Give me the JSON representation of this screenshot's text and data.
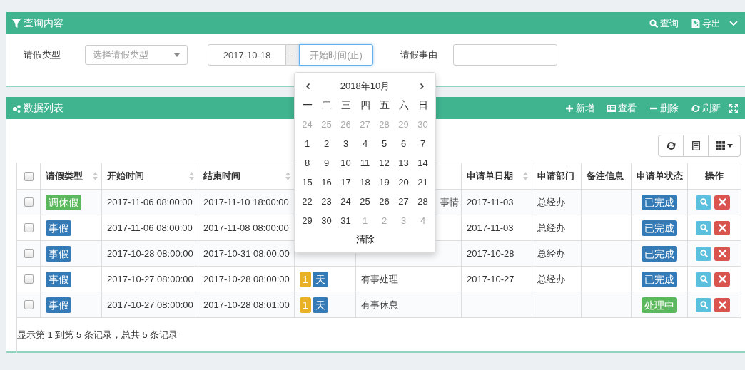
{
  "query_panel": {
    "title": "查询内容",
    "actions": [
      {
        "kind": "search",
        "label": "查询"
      },
      {
        "kind": "export",
        "label": "导出"
      }
    ],
    "fields": {
      "type_label": "请假类型",
      "type_placeholder": "选择请假类型",
      "date_from": "2017-10-18",
      "date_sep": "–",
      "date_to_placeholder": "开始时间(止)",
      "reason_label": "请假事由"
    }
  },
  "datepicker": {
    "title": "2018年10月",
    "weekdays": [
      "一",
      "二",
      "三",
      "四",
      "五",
      "六",
      "日"
    ],
    "days": [
      {
        "label": "24",
        "muted": true
      },
      {
        "label": "25",
        "muted": true
      },
      {
        "label": "26",
        "muted": true
      },
      {
        "label": "27",
        "muted": true
      },
      {
        "label": "28",
        "muted": true
      },
      {
        "label": "29",
        "muted": true
      },
      {
        "label": "30",
        "muted": true
      },
      {
        "label": "1",
        "muted": false
      },
      {
        "label": "2",
        "muted": false
      },
      {
        "label": "3",
        "muted": false
      },
      {
        "label": "4",
        "muted": false
      },
      {
        "label": "5",
        "muted": false
      },
      {
        "label": "6",
        "muted": false
      },
      {
        "label": "7",
        "muted": false
      },
      {
        "label": "8",
        "muted": false
      },
      {
        "label": "9",
        "muted": false
      },
      {
        "label": "10",
        "muted": false
      },
      {
        "label": "11",
        "muted": false
      },
      {
        "label": "12",
        "muted": false
      },
      {
        "label": "13",
        "muted": false
      },
      {
        "label": "14",
        "muted": false
      },
      {
        "label": "15",
        "muted": false
      },
      {
        "label": "16",
        "muted": false
      },
      {
        "label": "17",
        "muted": false
      },
      {
        "label": "18",
        "muted": false
      },
      {
        "label": "19",
        "muted": false
      },
      {
        "label": "20",
        "muted": false
      },
      {
        "label": "21",
        "muted": false
      },
      {
        "label": "22",
        "muted": false
      },
      {
        "label": "23",
        "muted": false
      },
      {
        "label": "24",
        "muted": false
      },
      {
        "label": "25",
        "muted": false
      },
      {
        "label": "26",
        "muted": false
      },
      {
        "label": "27",
        "muted": false
      },
      {
        "label": "28",
        "muted": false
      },
      {
        "label": "29",
        "muted": false
      },
      {
        "label": "30",
        "muted": false
      },
      {
        "label": "31",
        "muted": false
      },
      {
        "label": "1",
        "muted": true
      },
      {
        "label": "2",
        "muted": true
      },
      {
        "label": "3",
        "muted": true
      },
      {
        "label": "4",
        "muted": true
      }
    ],
    "clear": "清除"
  },
  "list_panel": {
    "title": "数据列表",
    "actions": [
      {
        "kind": "add",
        "label": "新增"
      },
      {
        "kind": "view",
        "label": "查看"
      },
      {
        "kind": "delete",
        "label": "删除"
      },
      {
        "kind": "refresh",
        "label": "刷新"
      }
    ]
  },
  "table": {
    "all_selected": false,
    "columns": [
      {
        "label": "请假类型",
        "sortable": true
      },
      {
        "label": "开始时间",
        "sortable": true
      },
      {
        "label": "结束时间",
        "sortable": true
      },
      {},
      {},
      {
        "label": "申请单日期",
        "sortable": true
      },
      {
        "label": "申请部门",
        "sortable": false
      },
      {
        "label": "备注信息",
        "sortable": false
      },
      {
        "label": "申请单状态",
        "sortable": false
      },
      {
        "label": "操作",
        "sortable": false
      }
    ],
    "rows": [
      {
        "selected": false,
        "type": {
          "label": "调休假",
          "color": "#5cb85c"
        },
        "start": "2017-11-06 08:00:00",
        "end": "2017-11-10 18:00:00",
        "reason": "事情",
        "reason_covered": true,
        "date": "2017-11-03",
        "dept": "总经办",
        "status": {
          "label": "已完成",
          "color": "#337ab7"
        }
      },
      {
        "selected": false,
        "type": {
          "label": "事假",
          "color": "#337ab7"
        },
        "start": "2017-11-06 08:00:00",
        "end": "2017-11-08 08:00:00",
        "date": "2017-11-03",
        "dept": "总经办",
        "status": {
          "label": "已完成",
          "color": "#337ab7"
        }
      },
      {
        "selected": false,
        "type": {
          "label": "事假",
          "color": "#337ab7"
        },
        "start": "2017-10-28 08:00:00",
        "end": "2017-10-31 08:00:00",
        "date": "2017-10-28",
        "dept": "总经办",
        "status": {
          "label": "已完成",
          "color": "#337ab7"
        }
      },
      {
        "selected": false,
        "type": {
          "label": "事假",
          "color": "#337ab7"
        },
        "start": "2017-10-27 08:00:00",
        "end": "2017-10-28 08:00:00",
        "days": {
          "count": "1",
          "unit": "天"
        },
        "reason": "有事处理",
        "date": "2017-10-27",
        "dept": "总经办",
        "status": {
          "label": "已完成",
          "color": "#337ab7"
        }
      },
      {
        "selected": false,
        "type": {
          "label": "事假",
          "color": "#337ab7"
        },
        "start": "2017-10-27 08:00:00",
        "end": "2017-10-28 08:01:00",
        "days": {
          "count": "1",
          "unit": "天"
        },
        "reason": "有事休息",
        "status": {
          "label": "处理中",
          "color": "#5cb85c"
        }
      }
    ],
    "footer": "显示第 1 到第 5 条记录，总共 5 条记录"
  }
}
